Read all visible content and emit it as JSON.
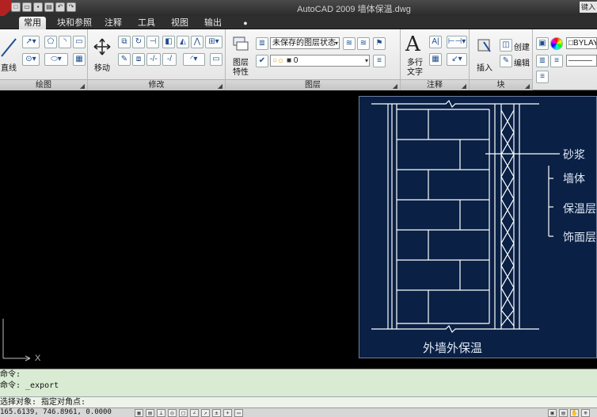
{
  "window": {
    "title": "AutoCAD 2009  墙体保温.dwg",
    "title_right": "键入"
  },
  "quick_access": [
    "new-icon",
    "open-icon",
    "save-icon",
    "print-icon",
    "undo-icon",
    "redo-icon"
  ],
  "tabs": [
    {
      "label": "常用",
      "active": true
    },
    {
      "label": "块和参照",
      "active": false
    },
    {
      "label": "注释",
      "active": false
    },
    {
      "label": "工具",
      "active": false
    },
    {
      "label": "视图",
      "active": false
    },
    {
      "label": "输出",
      "active": false
    }
  ],
  "ribbon": {
    "draw": {
      "label": "绘图",
      "line_label": "直线"
    },
    "modify": {
      "label": "修改",
      "move_label": "移动"
    },
    "layers": {
      "label": "图层",
      "props_label_1": "图层",
      "props_label_2": "特性",
      "layer_state": "未保存的图层状态",
      "current_layer": "0"
    },
    "annotation": {
      "label": "注释",
      "mtext_label_1": "多行",
      "mtext_label_2": "文字"
    },
    "block": {
      "label": "块",
      "insert_label": "插入",
      "create_label": "创建",
      "edit_label": "编辑"
    },
    "properties": {
      "bylayer": "BYLAY"
    }
  },
  "drawing": {
    "layer_labels": [
      "砂浆",
      "墙体",
      "保温层",
      "饰面层"
    ],
    "caption": "外墙外保温",
    "ucs_x": "X",
    "colors": {
      "background": "#000000",
      "frame": "#0a2045",
      "lines": "#ffffff"
    }
  },
  "command": {
    "history": [
      "命令:",
      "命令: _export"
    ],
    "prompt": "选择对象: 指定对角点:"
  },
  "status": {
    "coordinates": "165.6139, 746.8961, 0.0000"
  }
}
